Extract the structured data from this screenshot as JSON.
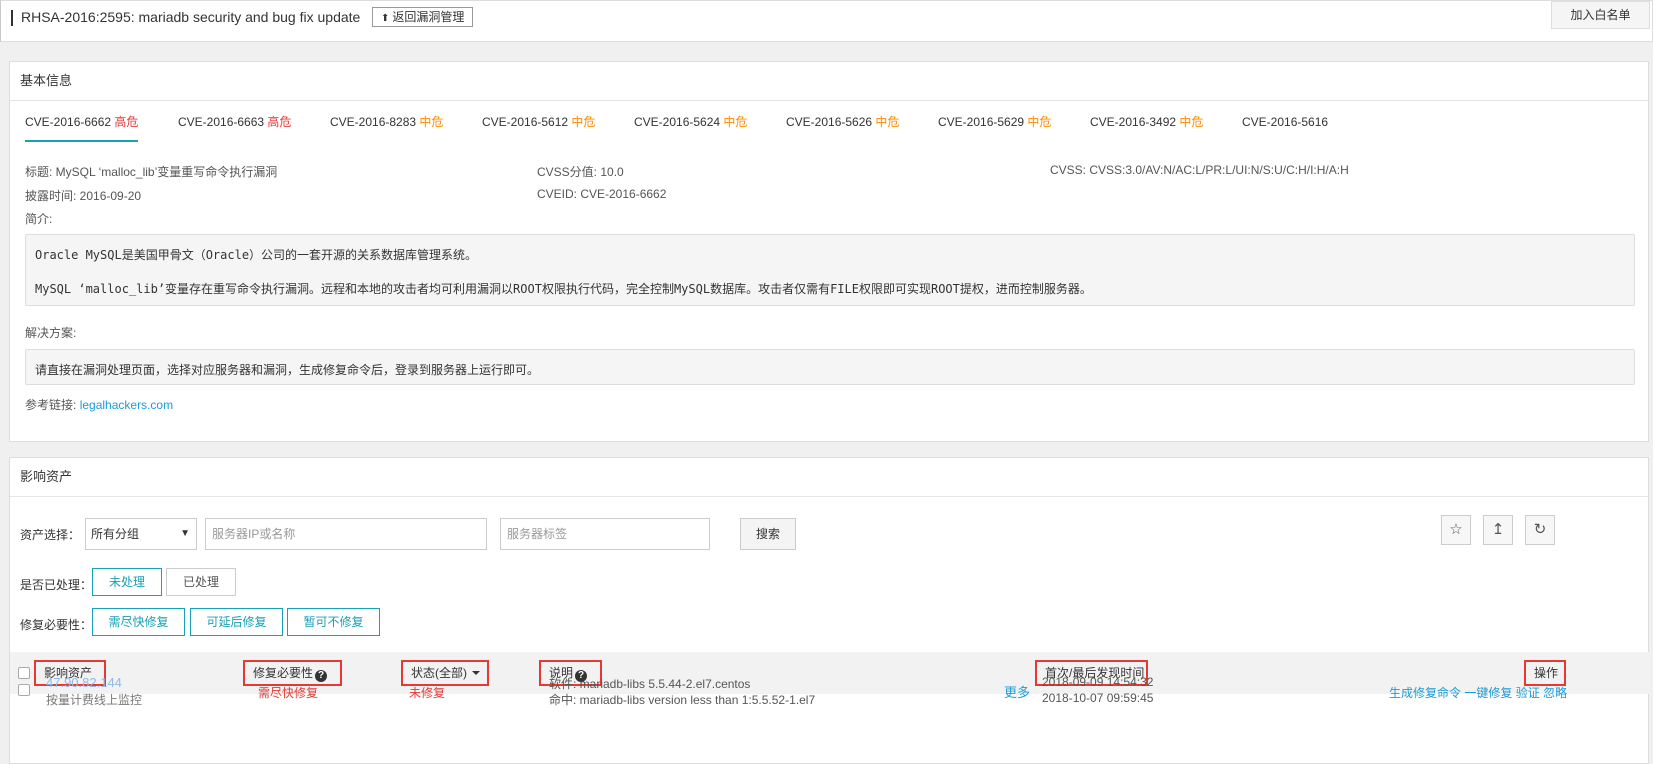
{
  "header": {
    "title": "RHSA-2016:2595: mariadb security and bug fix update",
    "back_label": "返回漏洞管理",
    "whitelist_label": "加入白名单"
  },
  "basic": {
    "heading": "基本信息",
    "tabs": [
      {
        "cve": "CVE-2016-6662",
        "severity": "高危",
        "level": "high"
      },
      {
        "cve": "CVE-2016-6663",
        "severity": "高危",
        "level": "high"
      },
      {
        "cve": "CVE-2016-8283",
        "severity": "中危",
        "level": "mid"
      },
      {
        "cve": "CVE-2016-5612",
        "severity": "中危",
        "level": "mid"
      },
      {
        "cve": "CVE-2016-5624",
        "severity": "中危",
        "level": "mid"
      },
      {
        "cve": "CVE-2016-5626",
        "severity": "中危",
        "level": "mid"
      },
      {
        "cve": "CVE-2016-5629",
        "severity": "中危",
        "level": "mid"
      },
      {
        "cve": "CVE-2016-3492",
        "severity": "中危",
        "level": "mid"
      },
      {
        "cve": "CVE-2016-5616",
        "severity": "",
        "level": ""
      }
    ],
    "title_line": "标题: MySQL ‘malloc_lib’变量重写命令执行漏洞",
    "cvss_score": "CVSS分值: 10.0",
    "cvss_vector": "CVSS: CVSS:3.0/AV:N/AC:L/PR:L/UI:N/S:U/C:H/I:H/A:H",
    "disclosed": "披露时间: 2016-09-20",
    "cveid": "CVEID: CVE-2016-6662",
    "intro_label": "简介:",
    "intro_p1": "Oracle MySQL是美国甲骨文（Oracle）公司的一套开源的关系数据库管理系统。",
    "intro_p2": "MySQL ‘malloc_lib’变量存在重写命令执行漏洞。远程和本地的攻击者均可利用漏洞以ROOT权限执行代码，完全控制MySQL数据库。攻击者仅需有FILE权限即可实现ROOT提权，进而控制服务器。",
    "solution_label": "解决方案:",
    "solution_text": "请直接在漏洞处理页面，选择对应服务器和漏洞，生成修复命令后，登录到服务器上运行即可。",
    "ref_label": "参考链接:",
    "ref_link": "legalhackers.com"
  },
  "assets": {
    "heading": "影响资产",
    "asset_select_label": "资产选择：",
    "group_select_value": "所有分组",
    "ip_placeholder": "服务器IP或名称",
    "tag_placeholder": "服务器标签",
    "search_label": "搜索",
    "processed_label": "是否已处理：",
    "processed_options": [
      "未处理",
      "已处理"
    ],
    "necessity_label": "修复必要性：",
    "necessity_options": [
      "需尽快修复",
      "可延后修复",
      "暂可不修复"
    ],
    "columns": {
      "asset": "影响资产",
      "necessity": "修复必要性",
      "status": "状态(全部)",
      "desc": "说明",
      "time": "首次/最后发现时间",
      "ops": "操作"
    },
    "rows": [
      {
        "asset_ip": "47.90.82.144",
        "billing": "按量计费线上监控",
        "necessity": "需尽快修复",
        "status": "未修复",
        "software": "软件: mariadb-libs 5.5.44-2.el7.centos",
        "match": "命中: mariadb-libs version less than 1:5.5.52-1.el7",
        "more": "更多",
        "first_seen": "2018-09-09 14:54:32",
        "last_seen": "2018-10-07 09:59:45",
        "actions": [
          "生成修复命令",
          "一键修复",
          "验证",
          "忽略"
        ]
      }
    ]
  }
}
